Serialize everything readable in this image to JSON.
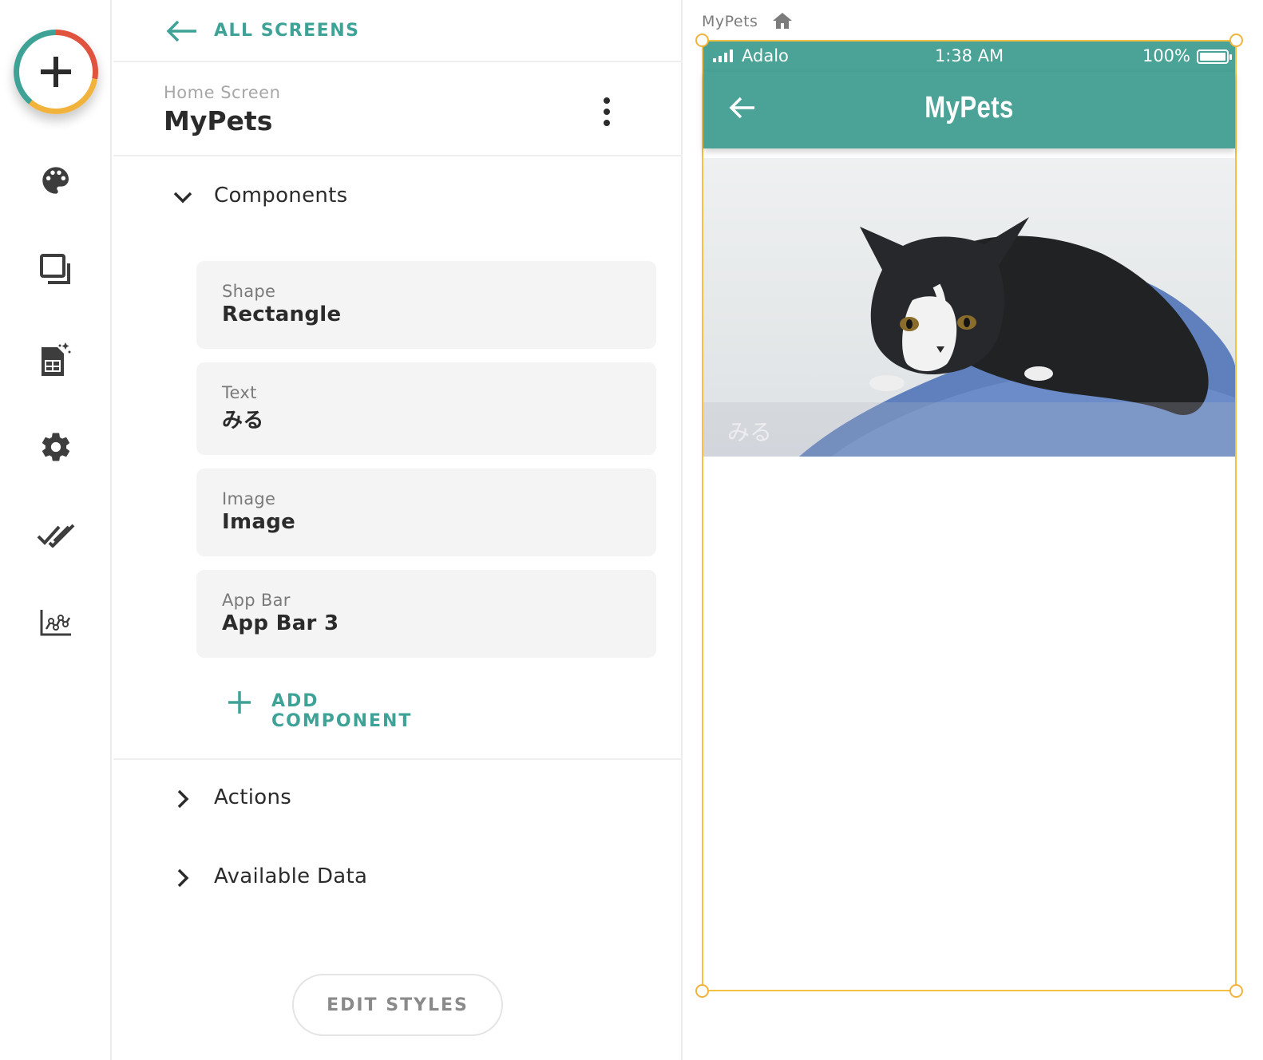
{
  "rail": {
    "icons": [
      "add-icon",
      "palette-icon",
      "screens-icon",
      "database-icon",
      "settings-icon",
      "publish-check-icon",
      "analytics-icon"
    ]
  },
  "panel": {
    "back_label": "ALL SCREENS",
    "screen_type": "Home Screen",
    "screen_name": "MyPets",
    "sections": {
      "components": "Components",
      "actions": "Actions",
      "available_data": "Available Data"
    },
    "components": [
      {
        "type": "Shape",
        "name": "Rectangle"
      },
      {
        "type": "Text",
        "name": "みる"
      },
      {
        "type": "Image",
        "name": "Image"
      },
      {
        "type": "App Bar",
        "name": "App Bar 3"
      }
    ],
    "add_component_label": "ADD COMPONENT",
    "edit_styles_label": "EDIT STYLES"
  },
  "canvas": {
    "screen_label": "MyPets",
    "status": {
      "carrier": "Adalo",
      "time": "1:38 AM",
      "battery": "100%"
    },
    "appbar_title": "MyPets",
    "image_caption": "みる"
  },
  "colors": {
    "accent": "#3ea396",
    "appbar": "#4aa396",
    "selection": "#f2b33d",
    "card_bg": "#f4f4f4"
  }
}
